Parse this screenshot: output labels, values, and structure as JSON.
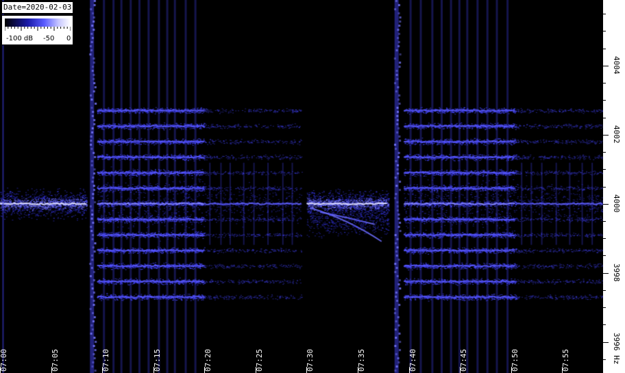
{
  "chart_data": {
    "type": "heatmap",
    "title": "",
    "date_label": "Date=2020-02-03",
    "colorbar": {
      "labels": [
        "-100 dB",
        "-50",
        "0"
      ],
      "range": [
        -100,
        0
      ]
    },
    "x_ticks": [
      "07:00",
      "07:05",
      "07:10",
      "07:15",
      "07:20",
      "07:25",
      "07:30",
      "07:35",
      "07:40",
      "07:45",
      "07:50",
      "07:55"
    ],
    "y_ticks": [
      "4004",
      "4002",
      "4000",
      "3998",
      "3996 Hz"
    ],
    "y_values": [
      4004,
      4002,
      4000,
      3998,
      3996
    ],
    "ylim": [
      3995.1,
      4005.9
    ],
    "xlim_minutes": [
      0,
      59
    ],
    "carrier_hz": 4000,
    "sideband_spacing_hz": 0.45,
    "segments": [
      {
        "start_min": 0,
        "end_min": 8.5,
        "kind": "carrier"
      },
      {
        "start_min": 9.5,
        "end_min": 20,
        "kind": "sidebands"
      },
      {
        "start_min": 20,
        "end_min": 29.5,
        "kind": "weak"
      },
      {
        "start_min": 30,
        "end_min": 38,
        "kind": "carrier-doppler"
      },
      {
        "start_min": 39.5,
        "end_min": 50.5,
        "kind": "sidebands"
      },
      {
        "start_min": 50.5,
        "end_min": 59,
        "kind": "weak"
      }
    ],
    "colors": {
      "low": "#000000",
      "mid": "#3a3cff",
      "high": "#ffffff"
    }
  }
}
